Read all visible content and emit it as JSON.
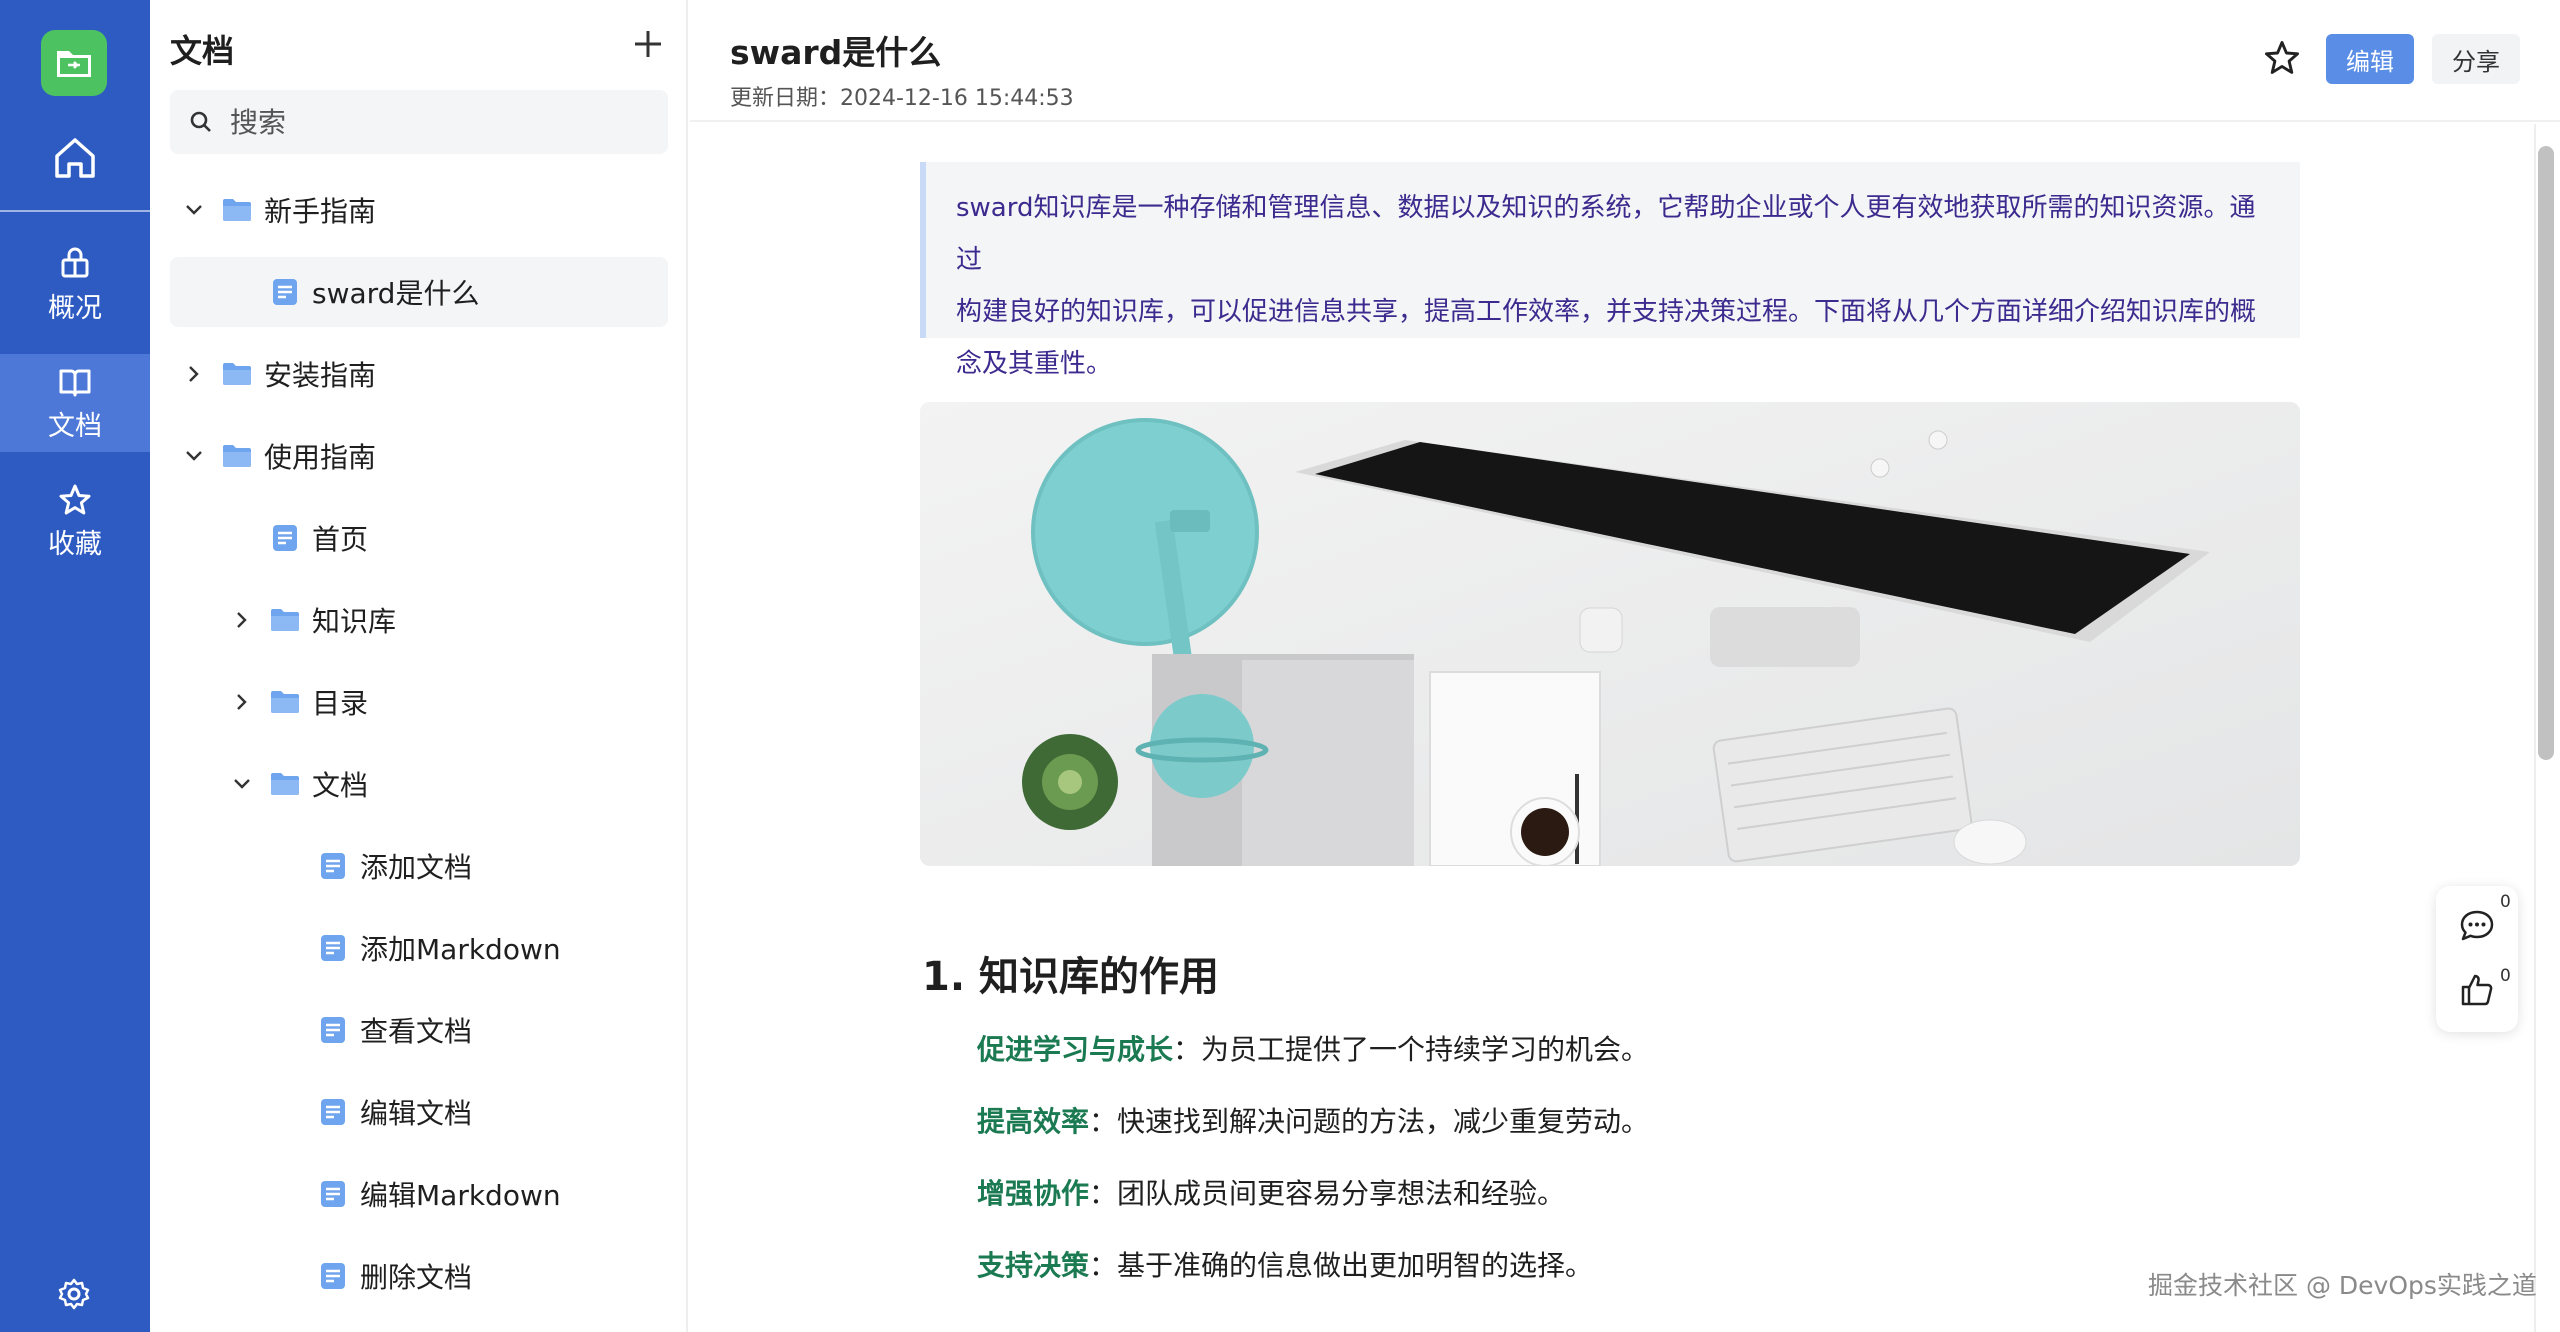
{
  "rail": {
    "items": [
      {
        "label": "概况",
        "icon": "overview-icon"
      },
      {
        "label": "文档",
        "icon": "book-icon",
        "active": true
      },
      {
        "label": "收藏",
        "icon": "star-icon"
      }
    ],
    "colors": {
      "background": "#2e5bc2",
      "active": "#4d78d8",
      "logo": "#4cc261"
    }
  },
  "tree": {
    "title": "文档",
    "search_placeholder": "搜索",
    "nodes": [
      {
        "label": "新手指南",
        "type": "folder",
        "expanded": true
      },
      {
        "label": "sward是什么",
        "type": "doc",
        "selected": true
      },
      {
        "label": "安装指南",
        "type": "folder",
        "expanded": false
      },
      {
        "label": "使用指南",
        "type": "folder",
        "expanded": true
      },
      {
        "label": "首页",
        "type": "doc"
      },
      {
        "label": "知识库",
        "type": "folder",
        "expanded": false
      },
      {
        "label": "目录",
        "type": "folder",
        "expanded": false
      },
      {
        "label": "文档",
        "type": "folder",
        "expanded": true
      },
      {
        "label": "添加文档",
        "type": "doc"
      },
      {
        "label": "添加Markdown",
        "type": "doc"
      },
      {
        "label": "查看文档",
        "type": "doc"
      },
      {
        "label": "编辑文档",
        "type": "doc"
      },
      {
        "label": "编辑Markdown",
        "type": "doc"
      },
      {
        "label": "删除文档",
        "type": "doc"
      }
    ]
  },
  "header": {
    "title": "sward是什么",
    "updated": "更新日期：2024-12-16 15:44:53",
    "edit_label": "编辑",
    "share_label": "分享"
  },
  "doc": {
    "quote_lines": [
      "sward知识库是一种存储和管理信息、数据以及知识的系统，它帮助企业或个人更有效地获取所需的知识资源。通过",
      "构建良好的知识库，可以促进信息共享，提高工作效率，并支持决策过程。下面将从几个方面详细介绍知识库的概",
      "念及其重性。"
    ],
    "heading": "1. 知识库的作用",
    "bullets": [
      {
        "key": "促进学习与成长",
        "text": "：为员工提供了一个持续学习的机会。"
      },
      {
        "key": "提高效率",
        "text": "：快速找到解决问题的方法，减少重复劳动。"
      },
      {
        "key": "增强协作",
        "text": "：团队成员间更容易分享想法和经验。"
      },
      {
        "key": "支持决策",
        "text": "：基于准确的信息做出更加明智的选择。"
      }
    ]
  },
  "float": {
    "comments": "0",
    "likes": "0"
  },
  "watermark": "掘金技术社区 @ DevOps实践之道"
}
